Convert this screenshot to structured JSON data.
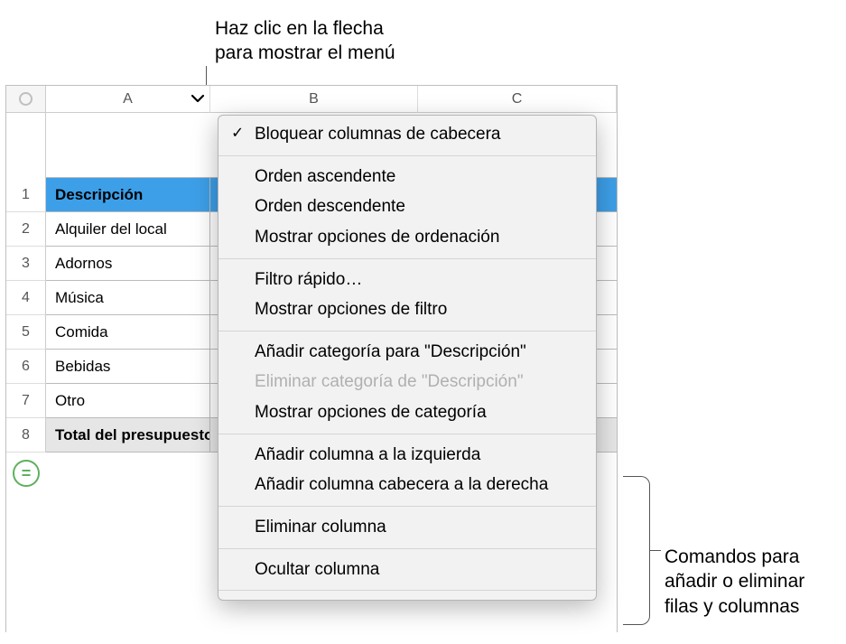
{
  "callouts": {
    "top_line1": "Haz clic en la flecha",
    "top_line2": "para mostrar el menú",
    "right_line1": "Comandos para",
    "right_line2": "añadir o eliminar",
    "right_line3": "filas y columnas"
  },
  "columns": {
    "a": "A",
    "b": "B",
    "c": "C"
  },
  "rows": {
    "r1": "1",
    "r2": "2",
    "r3": "3",
    "r4": "4",
    "r5": "5",
    "r6": "6",
    "r7": "7",
    "r8": "8"
  },
  "table": {
    "header": "Descripción",
    "rows": [
      "Alquiler del local",
      "Adornos",
      "Música",
      "Comida",
      "Bebidas",
      "Otro"
    ],
    "footer": "Total del presupuesto"
  },
  "menu": {
    "lock_headers": "Bloquear columnas de cabecera",
    "sort_asc": "Orden ascendente",
    "sort_desc": "Orden descendente",
    "sort_options": "Mostrar opciones de ordenación",
    "quick_filter": "Filtro rápido…",
    "filter_options": "Mostrar opciones de filtro",
    "add_category": "Añadir categoría para \"Descripción\"",
    "remove_category": "Eliminar categoría de \"Descripción\"",
    "category_options": "Mostrar opciones de categoría",
    "add_col_left": "Añadir columna a la izquierda",
    "add_col_right": "Añadir columna cabecera a la derecha",
    "delete_col": "Eliminar columna",
    "hide_col": "Ocultar columna"
  },
  "icons": {
    "formula": "="
  }
}
